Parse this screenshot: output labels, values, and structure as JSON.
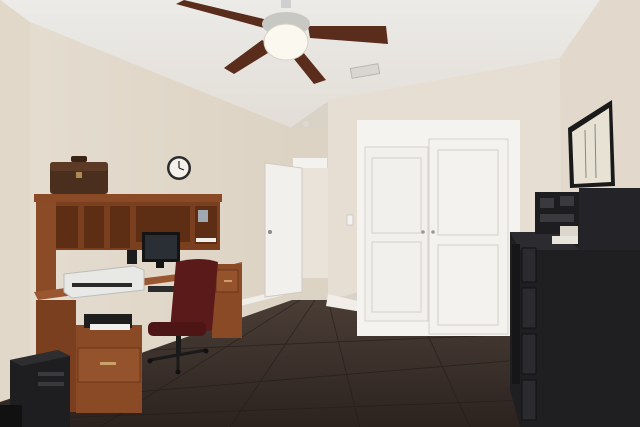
{
  "scene": {
    "description_free": true,
    "palette": {
      "wall": "#e6ddd0",
      "wall_shadow": "#d4cabb",
      "ceiling": "#ece8e3",
      "floor": "#3b302b",
      "floor_light": "#5a4a42",
      "wood": "#8a4a26",
      "wood_dark": "#6b3518",
      "door": "#f3f3f1",
      "dresser": "#1f1f22",
      "chair": "#5a1a1a",
      "fan_blade": "#5a2c1c"
    },
    "objects": [
      "ceiling-fan",
      "wall-clock",
      "desk-hutch",
      "printer",
      "monitor",
      "office-chair",
      "computer-tower",
      "doorway",
      "closet-double-door",
      "dresser",
      "framed-picture",
      "storage-box",
      "floor-vent"
    ]
  }
}
